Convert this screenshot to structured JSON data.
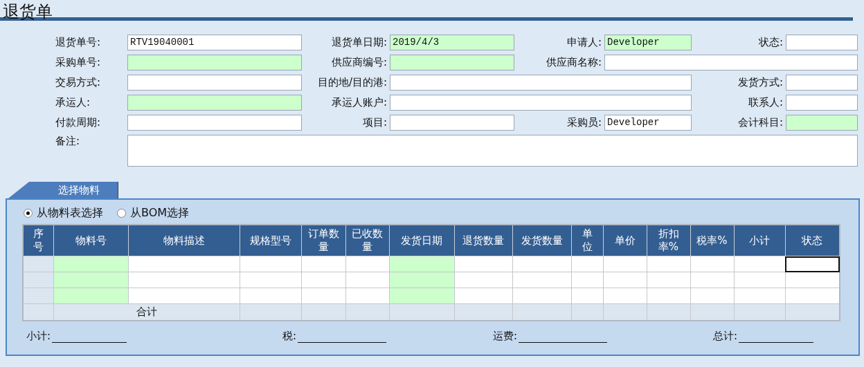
{
  "title": "退货单",
  "form": [
    {
      "label": "退货单号:",
      "value": "RTV19040001",
      "required": false,
      "kind": "normal"
    },
    {
      "label": "退货单日期:",
      "value": "2019/4/3",
      "required": true,
      "kind": "normal"
    },
    {
      "label": "申请人:",
      "value": "Developer",
      "required": true,
      "kind": "normal"
    },
    {
      "label": "状态:",
      "required": false,
      "kind": "normal"
    },
    {
      "label": "采购单号:",
      "required": true,
      "kind": "normal"
    },
    {
      "label": "供应商编号:",
      "required": true,
      "kind": "normal"
    },
    {
      "label": "供应商名称:",
      "required": false,
      "kind": "wide"
    },
    {
      "label": "交易方式:",
      "required": false,
      "kind": "normal"
    },
    {
      "label": "目的地/目的港:",
      "required": false,
      "kind": "wide"
    },
    {
      "label": "发货方式:",
      "required": false,
      "kind": "normal"
    },
    {
      "label": "承运人:",
      "required": true,
      "kind": "normal"
    },
    {
      "label": "承运人账户:",
      "required": false,
      "kind": "wide"
    },
    {
      "label": "联系人:",
      "required": false,
      "kind": "normal"
    },
    {
      "label": "付款周期:",
      "required": false,
      "kind": "normal"
    },
    {
      "label": "项目:",
      "required": false,
      "kind": "normal"
    },
    {
      "label": "采购员:",
      "value": "Developer",
      "required": false,
      "kind": "normal"
    },
    {
      "label": "会计科目:",
      "required": true,
      "kind": "normal"
    },
    {
      "label": "备注:",
      "required": false,
      "kind": "area"
    }
  ],
  "tab": {
    "label": "选择物料",
    "selected": true
  },
  "radios": [
    {
      "label": "从物料表选择",
      "selected": true
    },
    {
      "label": "从BOM选择",
      "selected": false
    }
  ],
  "table": {
    "columns": [
      {
        "label": "序号",
        "required": false
      },
      {
        "label": "物料号",
        "required": true
      },
      {
        "label": "物料描述",
        "required": false
      },
      {
        "label": "规格型号",
        "required": false
      },
      {
        "label": "订单数量",
        "required": false
      },
      {
        "label": "已收数量",
        "required": false
      },
      {
        "label": "发货日期",
        "required": true
      },
      {
        "label": "退货数量",
        "required": false
      },
      {
        "label": "发货数量",
        "required": false
      },
      {
        "label": "单位",
        "required": false
      },
      {
        "label": "单价",
        "required": false
      },
      {
        "label": "折扣率%",
        "required": false
      },
      {
        "label": "税率%",
        "required": false
      },
      {
        "label": "小计",
        "required": false
      },
      {
        "label": "状态",
        "required": false
      }
    ],
    "rows": [
      {
        "cells": [
          {
            "selected": false
          },
          {
            "selected": false
          },
          {
            "selected": false
          },
          {
            "selected": false
          },
          {
            "selected": false
          },
          {
            "selected": false
          },
          {
            "selected": false
          },
          {
            "selected": false
          },
          {
            "selected": false
          },
          {
            "selected": false
          },
          {
            "selected": false
          },
          {
            "selected": false
          },
          {
            "selected": false
          },
          {
            "selected": false
          },
          {
            "selected": true
          }
        ]
      },
      {
        "cells": [
          {
            "selected": false
          },
          {
            "selected": false
          },
          {
            "selected": false
          },
          {
            "selected": false
          },
          {
            "selected": false
          },
          {
            "selected": false
          },
          {
            "selected": false
          },
          {
            "selected": false
          },
          {
            "selected": false
          },
          {
            "selected": false
          },
          {
            "selected": false
          },
          {
            "selected": false
          },
          {
            "selected": false
          },
          {
            "selected": false
          },
          {
            "selected": false
          }
        ]
      },
      {
        "cells": [
          {
            "selected": false
          },
          {
            "selected": false
          },
          {
            "selected": false
          },
          {
            "selected": false
          },
          {
            "selected": false
          },
          {
            "selected": false
          },
          {
            "selected": false
          },
          {
            "selected": false
          },
          {
            "selected": false
          },
          {
            "selected": false
          },
          {
            "selected": false
          },
          {
            "selected": false
          },
          {
            "selected": false
          },
          {
            "selected": false
          },
          {
            "selected": false
          }
        ]
      }
    ],
    "total_label": "合计"
  },
  "totals": [
    {
      "label": "小计:"
    },
    {
      "label": "税:"
    },
    {
      "label": "运费:"
    },
    {
      "label": "总计:"
    }
  ]
}
